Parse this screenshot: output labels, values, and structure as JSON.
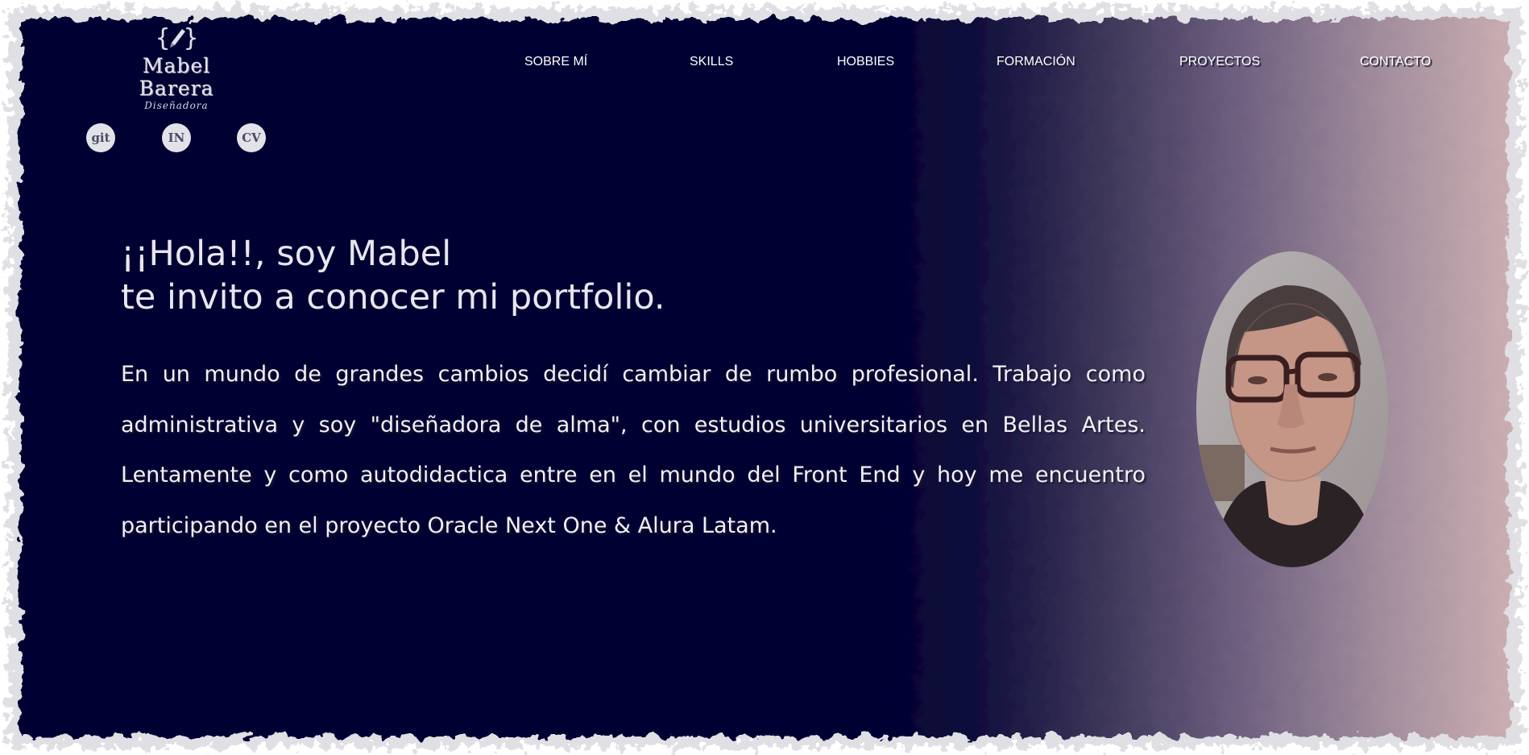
{
  "colors": {
    "panel_dark": "#020233",
    "panel_light": "#c9adb0",
    "text": "#f1f0f5",
    "social_bg": "#e2e2e8"
  },
  "logo": {
    "icon": "pencil-braces-icon",
    "name": "Mabel Barera",
    "subtitle": "Diseñadora"
  },
  "social": [
    {
      "label": "git",
      "icon": "github-icon"
    },
    {
      "label": "IN",
      "icon": "linkedin-icon"
    },
    {
      "label": "CV",
      "icon": "cv-icon"
    }
  ],
  "nav": {
    "items": [
      "SOBRE MÍ",
      "SKILLS",
      "HOBBIES",
      "FORMACIÓN",
      "PROYECTOS",
      "CONTACTO"
    ]
  },
  "hero": {
    "heading_line1": "¡¡Hola!!, soy Mabel",
    "heading_line2": "te invito a conocer mi portfolio.",
    "paragraph": "En un mundo de grandes cambios decidí cambiar de rumbo profesional. Trabajo como administrativa y soy \"diseñadora de alma\", con estudios universitarios en Bellas Artes. Lentamente y como autodidactica entre en el mundo del Front End y hoy me encuentro participando en el proyecto Oracle Next One & Alura Latam.",
    "portrait": "profile-photo"
  }
}
